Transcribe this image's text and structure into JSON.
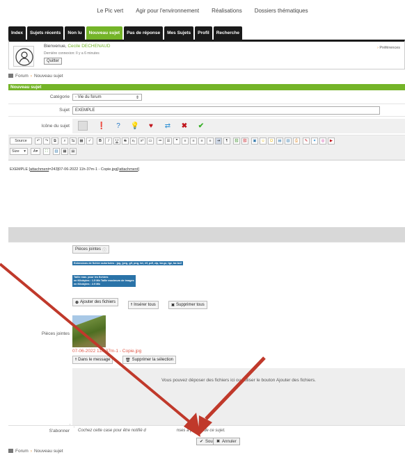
{
  "topnav": [
    "Le Pic vert",
    "Agir pour l'environnement",
    "Réalisations",
    "Dossiers thématiques"
  ],
  "tabs": [
    {
      "label": "Index"
    },
    {
      "label": "Sujets récents"
    },
    {
      "label": "Non lu"
    },
    {
      "label": "Nouveau sujet",
      "active": true
    },
    {
      "label": "Pas de réponse"
    },
    {
      "label": "Mes Sujets"
    },
    {
      "label": "Profil"
    },
    {
      "label": "Recherche"
    }
  ],
  "user": {
    "welcome": "Bienvenue,",
    "name": "Cecile DECHENAUD",
    "last_connection": "Dernière connexion: Il y a 6 minutes",
    "quit_label": "Quitter",
    "prefs_label": "Préférences"
  },
  "breadcrumb": {
    "forum": "Forum",
    "current": "Nouveau sujet"
  },
  "form": {
    "header": "Nouveau sujet",
    "category_label": "Catégorie",
    "category_value": "- Vie du forum",
    "subject_label": "Sujet",
    "subject_value": "EXEMPLE",
    "icon_label": "Icône du sujet"
  },
  "toolbar": {
    "source_label": "Source",
    "size_label": "Size"
  },
  "editor": {
    "text_before": "EXEMPLE [",
    "attach_open": "attachment",
    "text_mid": "=243]07-06-2022  11h-37m-1 - Copie.jpg[/",
    "attach_close": "attachment",
    "text_end": "]"
  },
  "attachments": {
    "label": "Pièces jointes",
    "tab_label": "Pièces jointes",
    "ext_label": "Extensions de fichier autorisées : jpg, jpeg, gif, png, txt, rtf, pdf, zip, tar.gz, tgz, tar.bz2",
    "size_line1": "Taille max. pour les fichiers",
    "size_line2": "en Kilobytes : 1.5 Mb Taille maximum de images",
    "size_line3": "en Kilobytes : 2.9 Mb",
    "add_button": "Ajouter des fichiers",
    "insert_all": "Insérer tous",
    "delete_all": "Supprimer tous",
    "file_name": "07-06-2022 11h-37m-1 - Copie.jpg",
    "in_message": "Dans le message",
    "delete_selection": "Supprimer la sélection",
    "drop_text": "Vous pouvez déposer des fichiers ici ou utiliser le bouton Ajouter des fichiers."
  },
  "subscribe": {
    "label": "S'abonner",
    "text_start": "Cochez cette case pour être notifié d",
    "text_end": "nses à propos de ce sujet."
  },
  "actions": {
    "submit": "Soumettre",
    "cancel": "Annuler"
  },
  "colors": {
    "accent": "#74b428",
    "tab_bg": "#1a1a1a",
    "arrow": "#c0392b"
  }
}
